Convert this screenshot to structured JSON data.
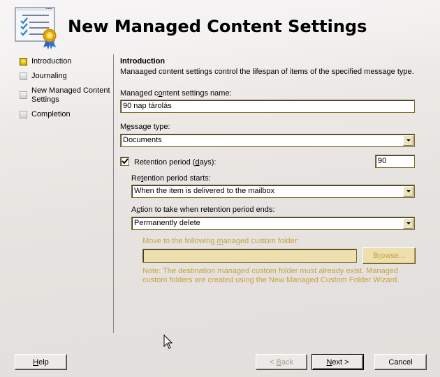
{
  "header": {
    "title": "New Managed Content Settings",
    "icon": "checklist-certificate-icon"
  },
  "nav": {
    "items": [
      {
        "label": "Introduction",
        "state": "active"
      },
      {
        "label": "Journaling",
        "state": "inactive"
      },
      {
        "label": "New Managed Content Settings",
        "state": "inactive"
      },
      {
        "label": "Completion",
        "state": "inactive"
      }
    ]
  },
  "content": {
    "section_title": "Introduction",
    "description": "Manaaged content settings control the lifespan of items of the specified message type.",
    "name_label": {
      "pre": "Managed c",
      "u": "o",
      "post": "ntent settings name:"
    },
    "name_value": "90 nap tárolás",
    "message_type_label": {
      "pre": "M",
      "u": "e",
      "post": "ssage type:"
    },
    "message_type_value": "Documents",
    "retention_checkbox": {
      "checked": true,
      "label_pre": "Retention period (",
      "label_u": "d",
      "label_post": "ays):"
    },
    "retention_days_value": "90",
    "retention_starts_label": {
      "pre": "Re",
      "u": "t",
      "post": "ention period starts:"
    },
    "retention_starts_value": "When the item is delivered to the mailbox",
    "action_label": {
      "pre": "A",
      "u": "c",
      "post": "tion to take when retention period ends:"
    },
    "action_value": "Permanently delete",
    "move_folder_label": {
      "pre": "Move to the following ",
      "u": "m",
      "post": "anaged custom folder:"
    },
    "move_folder_value": "",
    "browse_button": {
      "pre": "B",
      "u": "r",
      "post": "owse..."
    },
    "note": "Note: The destination managed custom folder must already exist. Managed custom folders are created using the New Managed Custom Folder Wizard."
  },
  "footer": {
    "help": {
      "u": "H",
      "post": "elp"
    },
    "back": {
      "pre": "< ",
      "u": "B",
      "post": "ack"
    },
    "next": {
      "u": "N",
      "post": "ext >"
    },
    "cancel": "Cancel"
  },
  "colors": {
    "disabled_text": "#c9a13c",
    "disabled_field": "#ede0ae",
    "active_step": "#e0b400"
  }
}
